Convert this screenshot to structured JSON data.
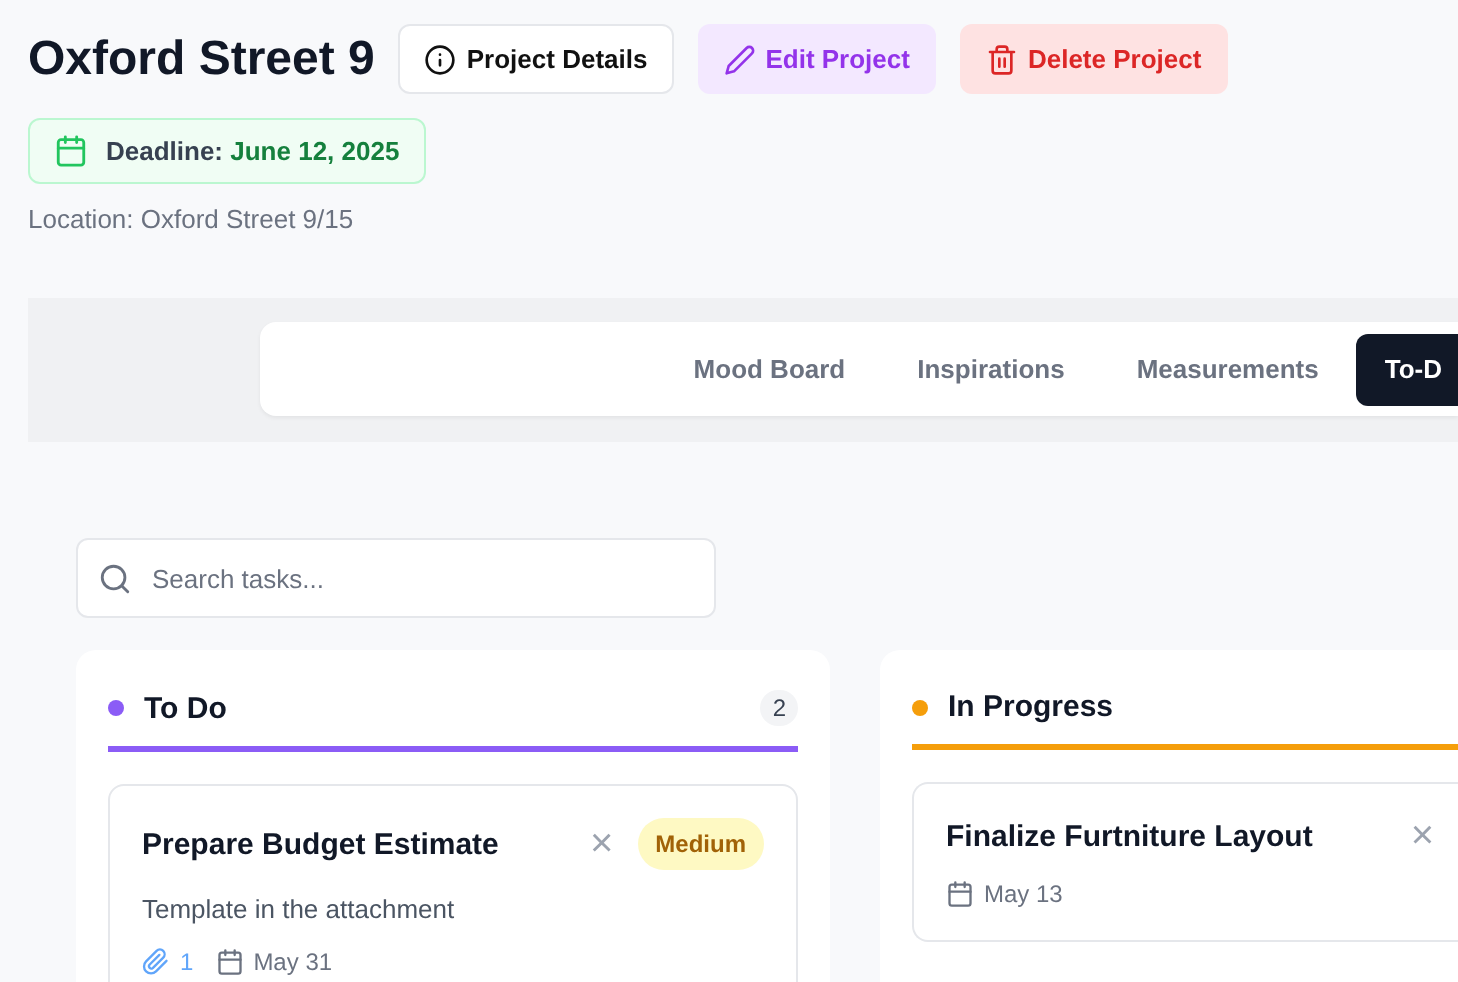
{
  "project": {
    "title": "Oxford Street 9",
    "actions": [
      {
        "kind": "details",
        "label": "Project Details"
      },
      {
        "kind": "edit",
        "label": "Edit Project"
      },
      {
        "kind": "delete",
        "label": "Delete Project"
      }
    ],
    "deadline_label": "Deadline:",
    "deadline_date": "June 12, 2025",
    "location": "Location: Oxford Street 9/15"
  },
  "tabs": [
    {
      "label": "Mood Board",
      "selected": false
    },
    {
      "label": "Inspirations",
      "selected": false
    },
    {
      "label": "Measurements",
      "selected": false
    },
    {
      "label": "To-D",
      "selected": true
    }
  ],
  "search": {
    "placeholder": "Search tasks..."
  },
  "columns": [
    {
      "title": "To Do",
      "color": "#8b5cf6",
      "count": "2",
      "cards": [
        {
          "title": "Prepare Budget Estimate",
          "priority": "Medium",
          "description": "Template in the attachment",
          "close": "×",
          "attachments": "1",
          "date": "May 31"
        }
      ]
    },
    {
      "title": "In Progress",
      "color": "#f59e0b",
      "cards": [
        {
          "title": "Finalize Furtniture Layout",
          "close": "×",
          "date": "May 13"
        }
      ]
    }
  ]
}
